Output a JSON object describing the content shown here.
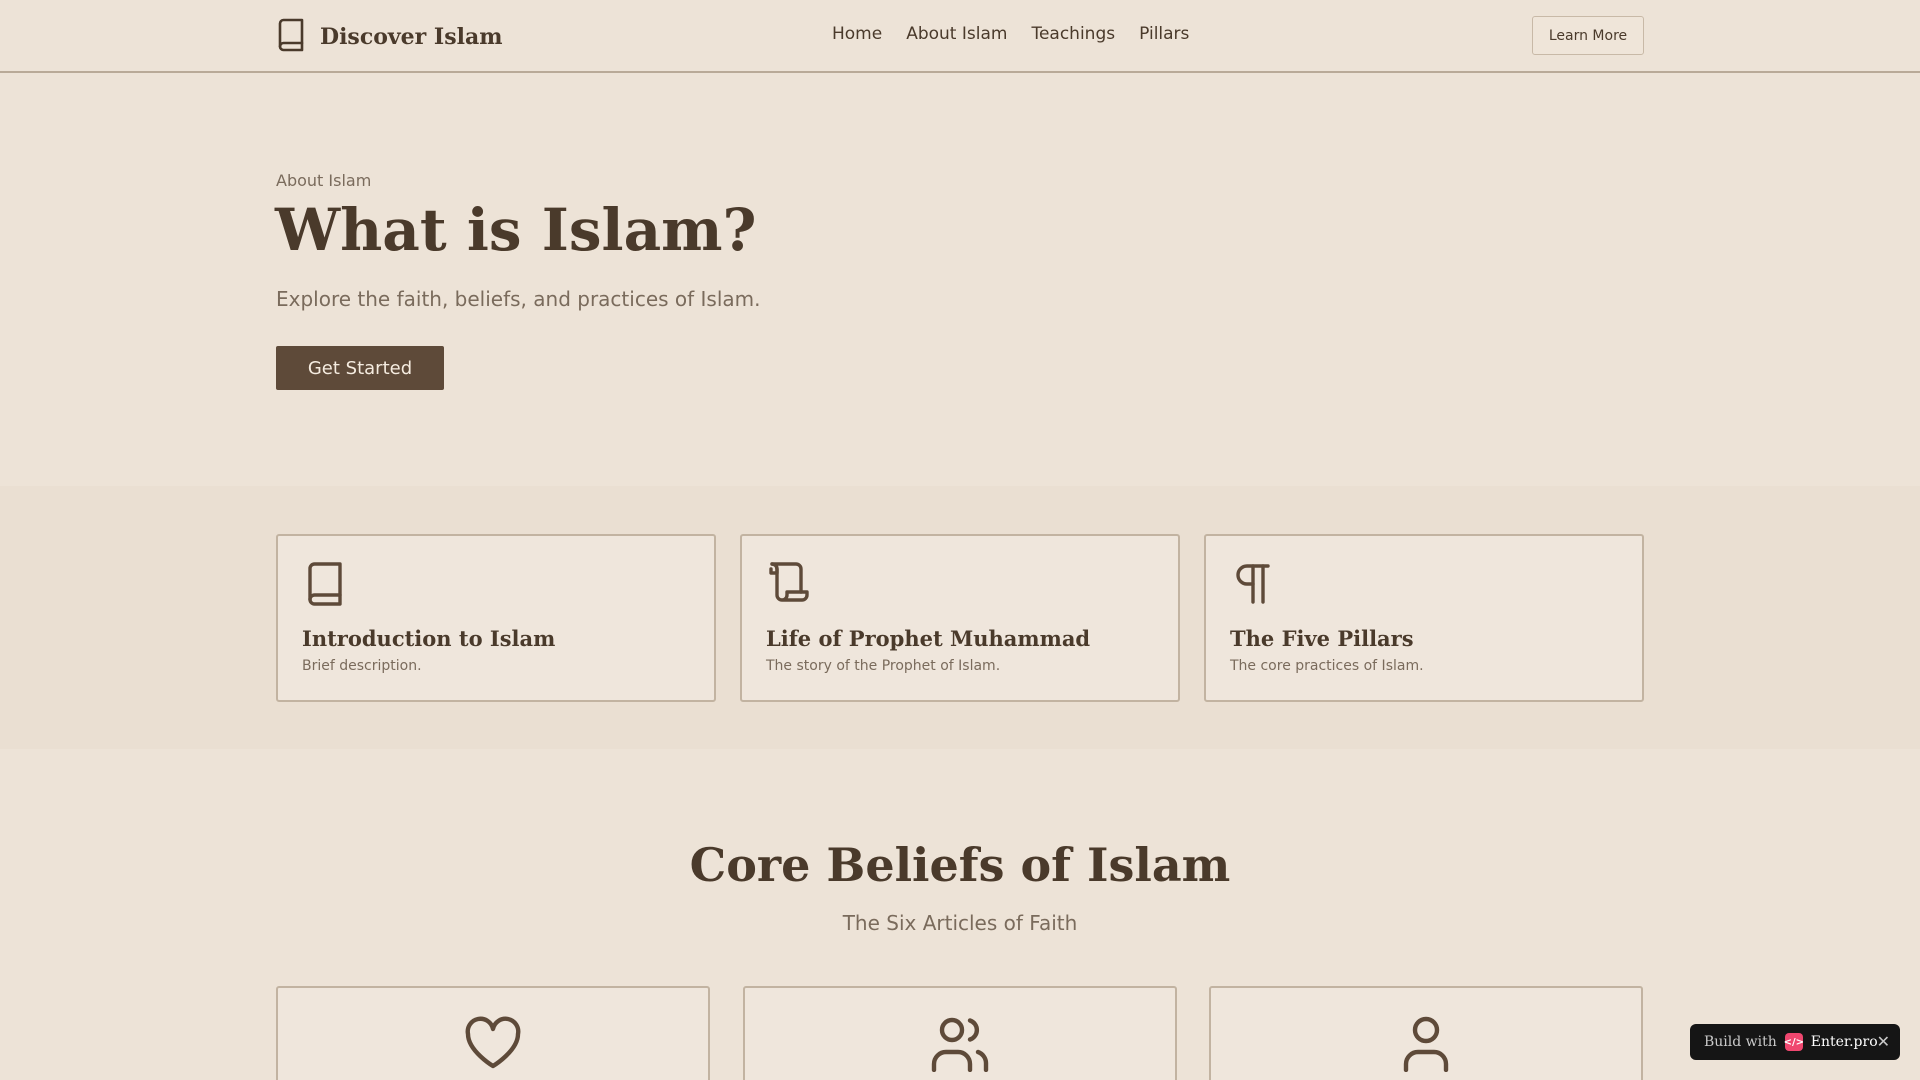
{
  "header": {
    "brand": "Discover Islam",
    "nav": [
      "Home",
      "About Islam",
      "Teachings",
      "Pillars"
    ],
    "learn_more": "Learn More"
  },
  "hero": {
    "eyebrow": "About Islam",
    "title": "What is Islam?",
    "subtitle": "Explore the faith, beliefs, and practices of Islam.",
    "cta": "Get Started"
  },
  "features": [
    {
      "icon": "book-icon",
      "title": "Introduction to Islam",
      "desc": "Brief description."
    },
    {
      "icon": "scroll-icon",
      "title": "Life of Prophet Muhammad",
      "desc": "The story of the Prophet of Islam."
    },
    {
      "icon": "pilcrow-icon",
      "title": "The Five Pillars",
      "desc": "The core practices of Islam."
    }
  ],
  "core": {
    "title": "Core Beliefs of Islam",
    "subtitle": "The Six Articles of Faith",
    "cards": [
      {
        "icon": "heart-icon"
      },
      {
        "icon": "users-icon"
      },
      {
        "icon": "user-icon"
      }
    ]
  },
  "badge": {
    "text": "Build with",
    "brand": "Enter.pro",
    "close": "✕"
  },
  "colors": {
    "background": "#ede3d7",
    "primary": "#5e4a39",
    "text": "#4a3a2b",
    "muted": "#7a6b5c"
  }
}
